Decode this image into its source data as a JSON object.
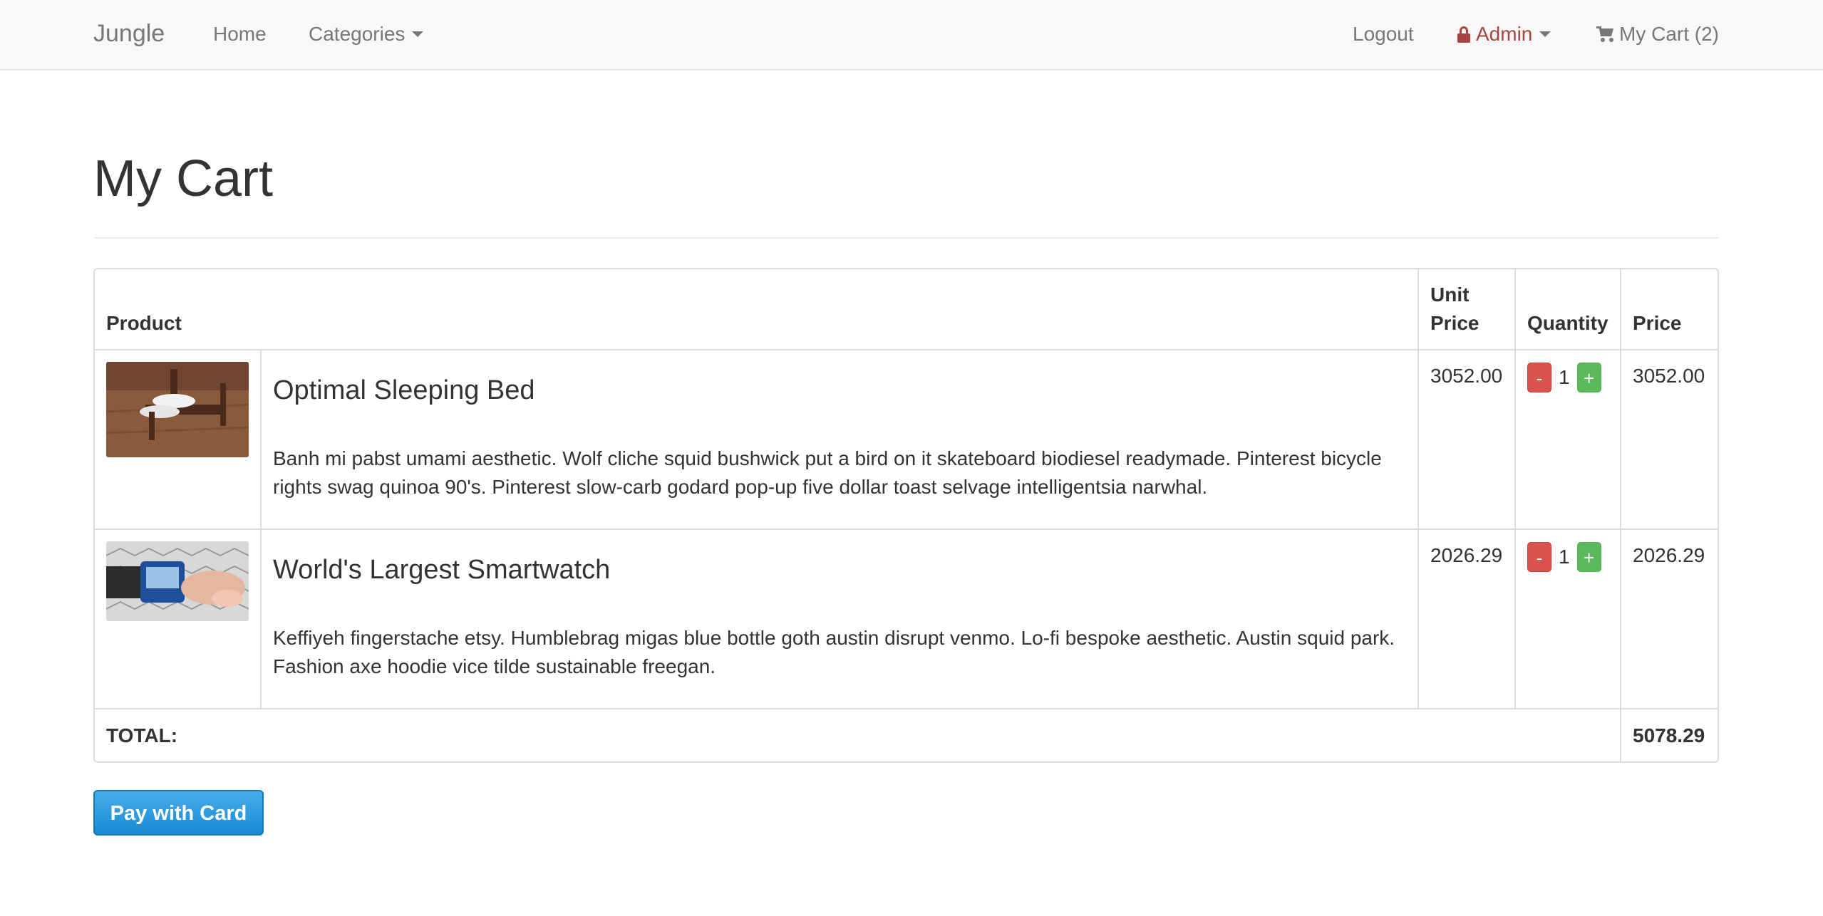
{
  "navbar": {
    "brand": "Jungle",
    "home": "Home",
    "categories": "Categories",
    "logout": "Logout",
    "admin": "Admin",
    "cart": "My Cart (2)"
  },
  "page": {
    "title": "My Cart"
  },
  "table": {
    "headers": {
      "product": "Product",
      "unit_price": "Unit Price",
      "quantity": "Quantity",
      "price": "Price"
    },
    "rows": [
      {
        "name": "Optimal Sleeping Bed",
        "description": "Banh mi pabst umami aesthetic. Wolf cliche squid bushwick put a bird on it skateboard biodiesel readymade. Pinterest bicycle rights swag quinoa 90's. Pinterest slow-carb godard pop-up five dollar toast selvage intelligentsia narwhal.",
        "unit_price": "3052.00",
        "quantity": "1",
        "price": "3052.00"
      },
      {
        "name": "World's Largest Smartwatch",
        "description": "Keffiyeh fingerstache etsy. Humblebrag migas blue bottle goth austin disrupt venmo. Lo-fi bespoke aesthetic. Austin squid park. Fashion axe hoodie vice tilde sustainable freegan.",
        "unit_price": "2026.29",
        "quantity": "1",
        "price": "2026.29"
      }
    ],
    "minus_label": "-",
    "plus_label": "+",
    "total_label": "TOTAL:",
    "total_value": "5078.29"
  },
  "pay_button": "Pay with Card",
  "colors": {
    "admin": "#a94442",
    "danger": "#d9534f",
    "success": "#5cb85c",
    "pay_button": "#1a8ad4"
  }
}
